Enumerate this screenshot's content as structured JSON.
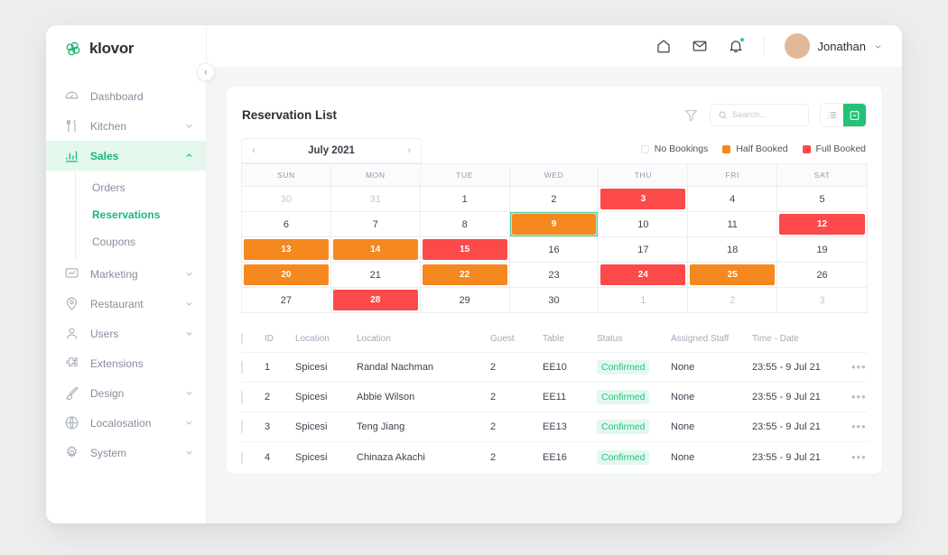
{
  "sidebar": {
    "brand": "klovor",
    "logo_icon": "clover-logo-icon",
    "collapse_icon": "chevron-left-icon",
    "items": [
      {
        "label": "Dashboard",
        "icon": "speedometer-icon",
        "chevron": false,
        "active": false
      },
      {
        "label": "Kitchen",
        "icon": "cutlery-icon",
        "chevron": true,
        "active": false
      },
      {
        "label": "Sales",
        "icon": "bar-chart-icon",
        "chevron": true,
        "active": true
      },
      {
        "label": "Marketing",
        "icon": "presentation-icon",
        "chevron": true,
        "active": false
      },
      {
        "label": "Restaurant",
        "icon": "map-pin-icon",
        "chevron": true,
        "active": false
      },
      {
        "label": "Users",
        "icon": "user-icon",
        "chevron": true,
        "active": false
      },
      {
        "label": "Extensions",
        "icon": "puzzle-icon",
        "chevron": false,
        "active": false
      },
      {
        "label": "Design",
        "icon": "brush-icon",
        "chevron": true,
        "active": false
      },
      {
        "label": "Localosation",
        "icon": "globe-icon",
        "chevron": true,
        "active": false
      },
      {
        "label": "System",
        "icon": "gear-icon",
        "chevron": true,
        "active": false
      }
    ],
    "subitems": [
      {
        "label": "Orders",
        "active": false
      },
      {
        "label": "Reservations",
        "active": true
      },
      {
        "label": "Coupons",
        "active": false
      }
    ]
  },
  "topbar": {
    "home_icon": "home-icon",
    "mail_icon": "mail-icon",
    "bell_icon": "bell-icon",
    "user_name": "Jonathan",
    "user_chevron_icon": "chevron-down-icon",
    "avatar_icon": "avatar"
  },
  "card": {
    "title": "Reservation List",
    "filter_icon": "filter-icon",
    "search": {
      "value": "",
      "placeholder": "Search...",
      "icon": "search-icon"
    },
    "view_toggle": [
      {
        "icon": "list-view-icon",
        "active": false
      },
      {
        "icon": "calendar-view-icon",
        "active": true
      }
    ]
  },
  "calendar": {
    "month": "July 2021",
    "prev_icon": "chevron-left-icon",
    "next_icon": "chevron-right-icon",
    "legend": [
      {
        "label": "No Bookings",
        "color": "#ffffff"
      },
      {
        "label": "Half Booked",
        "color": "#f5881f"
      },
      {
        "label": "Full Booked",
        "color": "#fc4a4a"
      }
    ],
    "weekdays": [
      "SUN",
      "MON",
      "TUE",
      "WED",
      "THU",
      "FRI",
      "SAT"
    ],
    "weeks": [
      [
        {
          "day": "30",
          "state": "muted"
        },
        {
          "day": "31",
          "state": "muted"
        },
        {
          "day": "1",
          "state": "none"
        },
        {
          "day": "2",
          "state": "none"
        },
        {
          "day": "3",
          "state": "full"
        },
        {
          "day": "4",
          "state": "none"
        },
        {
          "day": "5",
          "state": "none"
        }
      ],
      [
        {
          "day": "6",
          "state": "none"
        },
        {
          "day": "7",
          "state": "none"
        },
        {
          "day": "8",
          "state": "none"
        },
        {
          "day": "9",
          "state": "half",
          "selected": true
        },
        {
          "day": "10",
          "state": "none"
        },
        {
          "day": "11",
          "state": "none"
        },
        {
          "day": "12",
          "state": "full"
        }
      ],
      [
        {
          "day": "13",
          "state": "half"
        },
        {
          "day": "14",
          "state": "half"
        },
        {
          "day": "15",
          "state": "full"
        },
        {
          "day": "16",
          "state": "none"
        },
        {
          "day": "17",
          "state": "none"
        },
        {
          "day": "18",
          "state": "none"
        },
        {
          "day": "19",
          "state": "none"
        }
      ],
      [
        {
          "day": "20",
          "state": "half"
        },
        {
          "day": "21",
          "state": "none"
        },
        {
          "day": "22",
          "state": "half"
        },
        {
          "day": "23",
          "state": "none"
        },
        {
          "day": "24",
          "state": "full"
        },
        {
          "day": "25",
          "state": "half"
        },
        {
          "day": "26",
          "state": "none"
        }
      ],
      [
        {
          "day": "27",
          "state": "none"
        },
        {
          "day": "28",
          "state": "full"
        },
        {
          "day": "29",
          "state": "none"
        },
        {
          "day": "30",
          "state": "none"
        },
        {
          "day": "1",
          "state": "muted"
        },
        {
          "day": "2",
          "state": "muted"
        },
        {
          "day": "3",
          "state": "muted"
        }
      ]
    ]
  },
  "table": {
    "columns": [
      "",
      "ID",
      "Location",
      "Location",
      "Guest",
      "Table",
      "Status",
      "Assigned Staff",
      "Time - Date",
      ""
    ],
    "rows": [
      {
        "id": "1",
        "location": "Spicesi",
        "name": "Randal Nachman",
        "guest": "2",
        "table": "EE10",
        "status": "Confirmed",
        "staff": "None",
        "time": "23:55 - 9 Jul 21",
        "menu_icon": "more-horizontal-icon"
      },
      {
        "id": "2",
        "location": "Spicesi",
        "name": "Abbie Wilson",
        "guest": "2",
        "table": "EE11",
        "status": "Confirmed",
        "staff": "None",
        "time": "23:55 - 9 Jul 21",
        "menu_icon": "more-horizontal-icon"
      },
      {
        "id": "3",
        "location": "Spicesi",
        "name": "Teng Jiang",
        "guest": "2",
        "table": "EE13",
        "status": "Confirmed",
        "staff": "None",
        "time": "23:55 - 9 Jul 21",
        "menu_icon": "more-horizontal-icon"
      },
      {
        "id": "4",
        "location": "Spicesi",
        "name": "Chinaza Akachi",
        "guest": "2",
        "table": "EE16",
        "status": "Confirmed",
        "staff": "None",
        "time": "23:55 - 9 Jul 21",
        "menu_icon": "more-horizontal-icon"
      }
    ]
  },
  "colors": {
    "accent_green": "#23c277",
    "half_booked": "#f5881f",
    "full_booked": "#fc4a4a",
    "badge_bg": "#e3f8ef"
  }
}
